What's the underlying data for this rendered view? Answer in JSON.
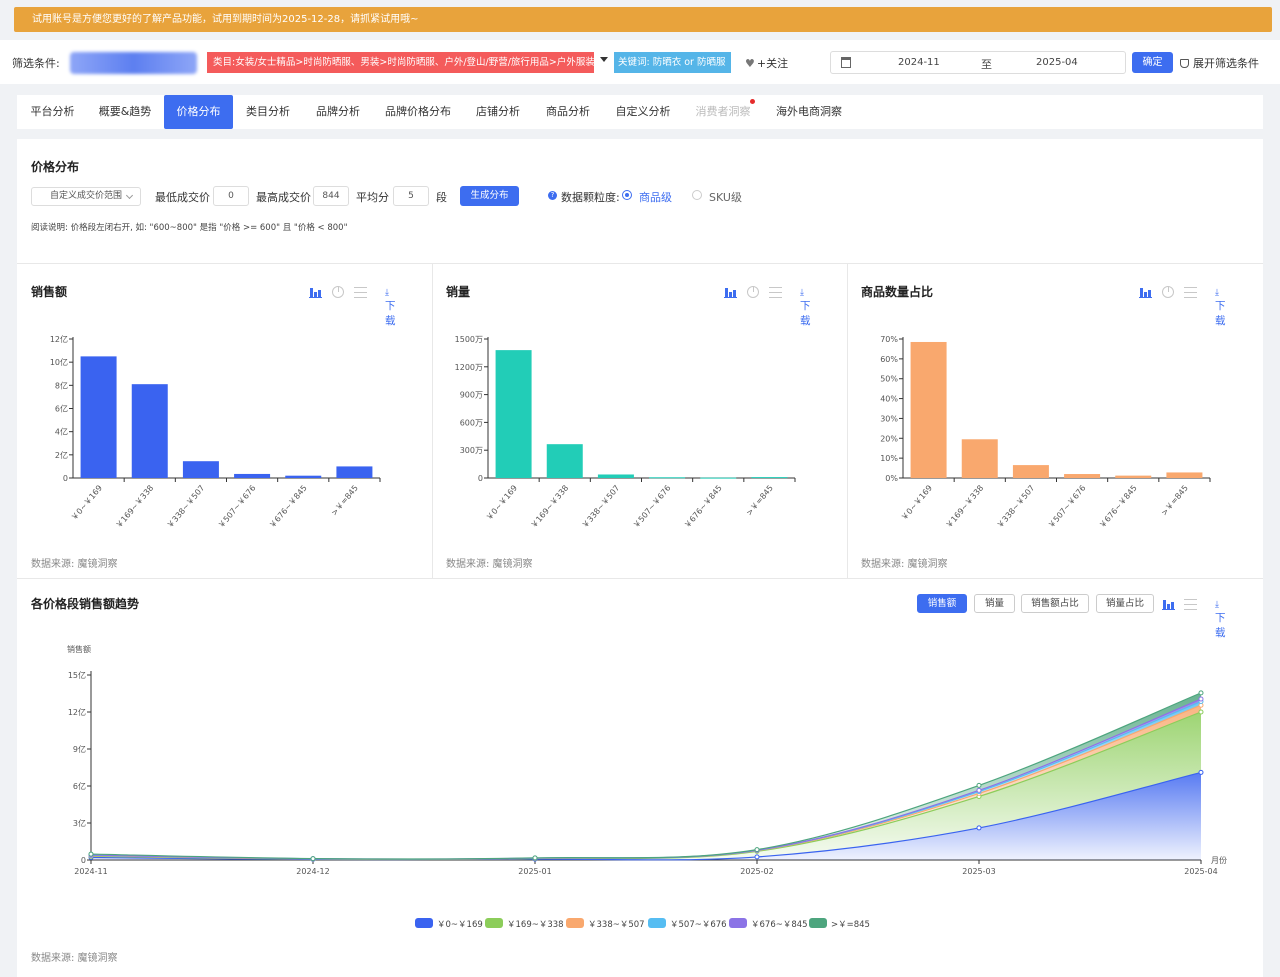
{
  "banner": {
    "text": "试用账号是方便您更好的了解产品功能，试用到期时间为2025-12-28，请抓紧试用哦~"
  },
  "filter": {
    "label": "筛选条件:",
    "category_tag": "类目:女装/女士精品>时尚防晒服、男装>时尚防晒服、户外/登山/野营/旅行用品>户外服装>防晒衣",
    "keyword_tag": "关键词: 防晒衣 or 防晒服",
    "follow_label": "+关注",
    "date_start": "2024-11",
    "date_sep": "至",
    "date_end": "2025-04",
    "ok_label": "确定",
    "expand_label": "展开筛选条件"
  },
  "tabs": [
    "平台分析",
    "概要&趋势",
    "价格分布",
    "类目分析",
    "品牌分析",
    "品牌价格分布",
    "店铺分析",
    "商品分析",
    "自定义分析",
    "消费者洞察",
    "海外电商洞察"
  ],
  "active_tab": "价格分布",
  "disabled_tab": "消费者洞察",
  "price_dist": {
    "title": "价格分布",
    "range_select": "自定义成交价范围",
    "min_label": "最低成交价",
    "min_value": "0",
    "max_label": "最高成交价",
    "max_value": "844",
    "split_label": "平均分",
    "split_value": "5",
    "seg_label": "段",
    "gen_label": "生成分布",
    "granularity_label": "数据颗粒度:",
    "option_product": "商品级",
    "option_sku": "SKU级",
    "note": "阅读说明: 价格段左闭右开, 如: \"600~800\" 是指 \"价格 >= 600\" 且 \"价格 < 800\""
  },
  "download_label": "下载",
  "source_label": "数据来源: 魔镜洞察",
  "chart_data": [
    {
      "type": "bar",
      "title": "销售额",
      "categories": [
        "￥0~￥169",
        "￥169~￥338",
        "￥338~￥507",
        "￥507~￥676",
        "￥676~￥845",
        ">￥=845"
      ],
      "values": [
        10.5,
        8.1,
        1.45,
        0.35,
        0.2,
        1.0
      ],
      "unit": "亿",
      "yticks": [
        "0",
        "2亿",
        "4亿",
        "6亿",
        "8亿",
        "10亿",
        "12亿"
      ],
      "ylim": [
        0,
        12
      ],
      "color": "#3a63f0"
    },
    {
      "type": "bar",
      "title": "销量",
      "categories": [
        "￥0~￥169",
        "￥169~￥338",
        "￥338~￥507",
        "￥507~￥676",
        "￥676~￥845",
        ">￥=845"
      ],
      "values": [
        1380,
        365,
        38,
        8,
        4,
        10
      ],
      "unit": "万",
      "yticks": [
        "0",
        "300万",
        "600万",
        "900万",
        "1200万",
        "1500万"
      ],
      "ylim": [
        0,
        1500
      ],
      "color": "#22cdb7"
    },
    {
      "type": "bar",
      "title": "商品数量占比",
      "categories": [
        "￥0~￥169",
        "￥169~￥338",
        "￥338~￥507",
        "￥507~￥676",
        "￥676~￥845",
        ">￥=845"
      ],
      "values": [
        68.5,
        19.5,
        6.5,
        2.0,
        1.2,
        2.8
      ],
      "unit": "%",
      "yticks": [
        "0%",
        "10%",
        "20%",
        "30%",
        "40%",
        "50%",
        "60%",
        "70%"
      ],
      "ylim": [
        0,
        70
      ],
      "color": "#f9a86e"
    },
    {
      "type": "area",
      "title": "各价格段销售额趋势",
      "ylabel": "销售额",
      "xlabel": "月份",
      "x": [
        "2024-11",
        "2024-12",
        "2025-01",
        "2025-02",
        "2025-03",
        "2025-04"
      ],
      "yticks": [
        "0",
        "3亿",
        "6亿",
        "9亿",
        "12亿",
        "15亿"
      ],
      "ylim": [
        0,
        15
      ],
      "stacked": true,
      "series": [
        {
          "name": "￥0~￥169",
          "color": "#3a63f0",
          "values": [
            0.2,
            0.05,
            0.07,
            0.25,
            2.6,
            7.1
          ]
        },
        {
          "name": "￥169~￥338",
          "color": "#8ccd5a",
          "values": [
            0.1,
            0.03,
            0.05,
            0.45,
            2.55,
            4.9
          ]
        },
        {
          "name": "￥338~￥507",
          "color": "#f9a86e",
          "values": [
            0.05,
            0.01,
            0.02,
            0.06,
            0.25,
            0.55
          ]
        },
        {
          "name": "￥507~￥676",
          "color": "#56bdf2",
          "values": [
            0.03,
            0.01,
            0.01,
            0.02,
            0.15,
            0.3
          ]
        },
        {
          "name": "￥676~￥845",
          "color": "#8b73e6",
          "values": [
            0.02,
            0.005,
            0.005,
            0.01,
            0.1,
            0.2
          ]
        },
        {
          "name": ">￥=845",
          "color": "#4da57e",
          "values": [
            0.08,
            0.01,
            0.02,
            0.05,
            0.4,
            0.5
          ]
        }
      ],
      "metric_buttons": [
        "销售额",
        "销量",
        "销售额占比",
        "销量占比"
      ],
      "active_metric": "销售额"
    }
  ]
}
